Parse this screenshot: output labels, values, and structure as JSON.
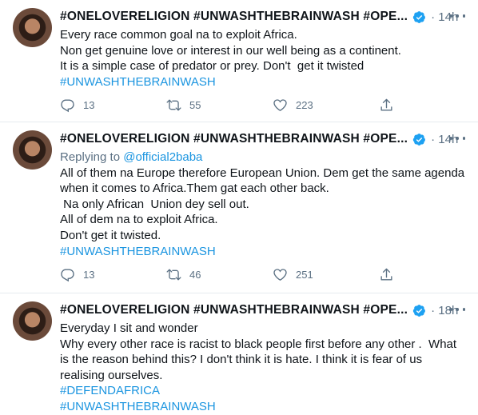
{
  "tweets": [
    {
      "name": "#ONELOVERELIGION #UNWASHTHEBRAINWASH #OPE...",
      "time": "14h",
      "replying_prefix": "",
      "replying_handle": "",
      "lines": [
        "Every race common goal na to exploit Africa.",
        "Non get genuine love or interest in our well being as a continent.",
        "It is a simple case of predator or prey. Don't  get it twisted"
      ],
      "hashtags": [
        "#UNWASHTHEBRAINWASH"
      ],
      "replies": "13",
      "retweets": "55",
      "likes": "223"
    },
    {
      "name": "#ONELOVERELIGION #UNWASHTHEBRAINWASH #OPE...",
      "time": "14h",
      "replying_prefix": "Replying to ",
      "replying_handle": "@official2baba",
      "lines": [
        "All of them na Europe therefore European Union. Dem get the same agenda",
        "when it comes to Africa.Them gat each other back.",
        " Na only African  Union dey sell out.",
        "All of dem na to exploit Africa.",
        "Don't get it twisted."
      ],
      "hashtags": [
        "#UNWASHTHEBRAINWASH"
      ],
      "replies": "13",
      "retweets": "46",
      "likes": "251"
    },
    {
      "name": "#ONELOVERELIGION #UNWASHTHEBRAINWASH #OPE...",
      "time": "18h",
      "replying_prefix": "",
      "replying_handle": "",
      "lines": [
        "Everyday I sit and wonder",
        "Why every other race is racist to black people first before any other .  What",
        "is the reason behind this? I don't think it is hate. I think it is fear of us",
        "realising ourselves."
      ],
      "hashtags": [
        "#DEFENDAFRICA",
        "#UNWASHTHEBRAINWASH"
      ],
      "replies": "",
      "retweets": "",
      "likes": ""
    }
  ],
  "icons": {
    "verified": "verified-badge-icon",
    "more": "more-options-icon",
    "reply": "reply-icon",
    "retweet": "retweet-icon",
    "like": "heart-icon",
    "share": "share-icon"
  },
  "colors": {
    "link": "#1b95e0",
    "muted": "#5b7083",
    "text": "#0f1419",
    "verified": "#1da1f2"
  }
}
